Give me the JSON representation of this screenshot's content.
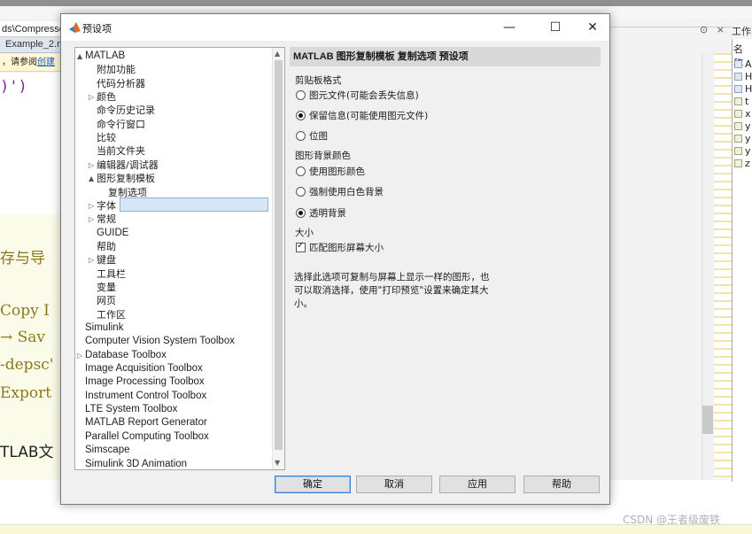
{
  "background": {
    "path_text": "ds\\Compresse",
    "tab_label": "Example_2.m",
    "info_text": "，请参阅",
    "info_link": "创建",
    "code_text": ")')",
    "doc_lines": [
      "存与导",
      "Copy I",
      "→ Sav",
      "-depsc'",
      "Export",
      "TLAB文"
    ],
    "window_controls": "⊙ ×",
    "workspace_title": "工作",
    "workspace_header": "名称",
    "workspace_items": [
      "A",
      "H",
      "H",
      "t",
      "x",
      "y",
      "y",
      "y",
      "z"
    ]
  },
  "dialog": {
    "title": "预设项",
    "minimize": "—",
    "maximize": "☐",
    "close": "✕",
    "tree": [
      {
        "label": "MATLAB",
        "arrow": "▲"
      },
      {
        "label": "附加功能"
      },
      {
        "label": "代码分析器"
      },
      {
        "label": "颜色",
        "arrow": "▷"
      },
      {
        "label": "命令历史记录"
      },
      {
        "label": "命令行窗口"
      },
      {
        "label": "比较"
      },
      {
        "label": "当前文件夹"
      },
      {
        "label": "编辑器/调试器",
        "arrow": "▷"
      },
      {
        "label": "图形复制模板",
        "arrow": "▲"
      },
      {
        "label": "复制选项",
        "selected": true
      },
      {
        "label": "字体",
        "arrow": "▷"
      },
      {
        "label": "常规",
        "arrow": "▷"
      },
      {
        "label": "GUIDE"
      },
      {
        "label": "帮助"
      },
      {
        "label": "键盘",
        "arrow": "▷"
      },
      {
        "label": "工具栏"
      },
      {
        "label": "变量"
      },
      {
        "label": "网页"
      },
      {
        "label": "工作区"
      },
      {
        "label": "Simulink"
      },
      {
        "label": "Computer Vision System Toolbox"
      },
      {
        "label": "Database Toolbox",
        "arrow": "▷"
      },
      {
        "label": "Image Acquisition Toolbox"
      },
      {
        "label": "Image Processing Toolbox"
      },
      {
        "label": "Instrument Control Toolbox"
      },
      {
        "label": "LTE System Toolbox"
      },
      {
        "label": "MATLAB Report Generator"
      },
      {
        "label": "Parallel Computing Toolbox"
      },
      {
        "label": "Simscape"
      },
      {
        "label": "Simulink 3D Animation"
      }
    ],
    "panel": {
      "header": "MATLAB 图形复制模板 复制选项 预设项",
      "clipboard_title": "剪贴板格式",
      "clipboard_options": [
        "图元文件(可能会丢失信息)",
        "保留信息(可能使用图元文件)",
        "位图"
      ],
      "clipboard_selected": 1,
      "bg_title": "图形背景颜色",
      "bg_options": [
        "使用图形颜色",
        "强制使用白色背景",
        "透明背景"
      ],
      "bg_selected": 2,
      "size_title": "大小",
      "match_size_label": "匹配图形屏幕大小",
      "match_size_checked": true,
      "description": "选择此选项可复制与屏幕上显示一样的图形，也可以取消选择，使用\"打印预览\"设置来确定其大小。"
    },
    "buttons": {
      "ok": "确定",
      "cancel": "取消",
      "apply": "应用",
      "help": "帮助"
    }
  },
  "watermark": "CSDN @王者级废铁"
}
